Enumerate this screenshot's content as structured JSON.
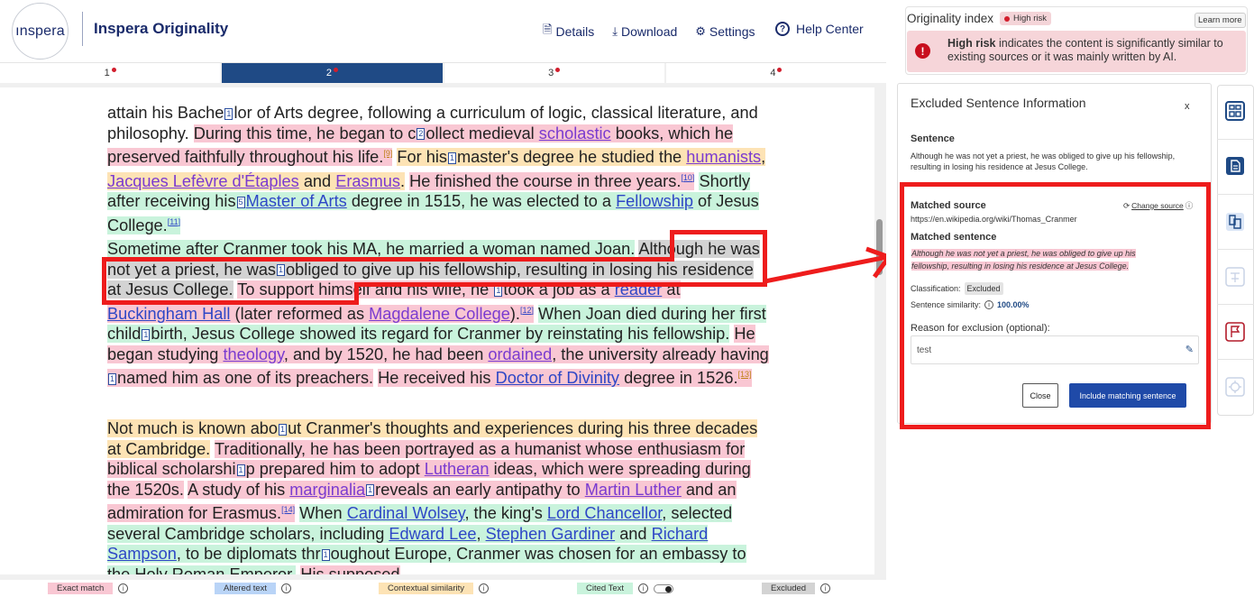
{
  "brand": {
    "logo_text": "ınspera",
    "title": "Inspera Originality"
  },
  "topnav": [
    {
      "icon": "document-icon",
      "label": "Details"
    },
    {
      "icon": "download-icon",
      "label": "Download"
    },
    {
      "icon": "gear-icon",
      "label": "Settings"
    }
  ],
  "help": {
    "icon": "question-icon",
    "label": "Help Center"
  },
  "pages": [
    "1",
    "2",
    "3",
    "4"
  ],
  "active_page": "2",
  "legend": {
    "exact": "Exact match",
    "altered": "Altered text",
    "contextual": "Contextual similarity",
    "cited": "Cited Text",
    "excluded": "Excluded"
  },
  "originality": {
    "title": "Originality index",
    "badge": "High risk",
    "learn_more": "Learn more",
    "alert_bold": "High risk",
    "alert_text": " indicates the content is significantly similar to existing sources or it was mainly written by AI."
  },
  "panel": {
    "title": "Excluded Sentence Information",
    "close_x": "x",
    "sentence_label": "Sentence",
    "sentence_text": "Although he was not yet a priest, he was obliged to give up his fellowship, resulting in losing his residence at Jesus College.",
    "matched_source_label": "Matched source",
    "matched_source_url": "https://en.wikipedia.org/wiki/Thomas_Cranmer",
    "change_source": "Change source",
    "matched_sentence_label": "Matched sentence",
    "matched_sentence_text": "Although he was not yet a priest, he was obliged to give up his fellowship, resulting in losing his residence at Jesus College.",
    "classification_label": "Classification:",
    "classification_value": "Excluded",
    "similarity_label": "Sentence similarity:",
    "similarity_value": "100.00%",
    "reason_label": "Reason for exclusion (optional):",
    "reason_value": "test",
    "close_button": "Close",
    "include_button": "Include matching sentence"
  },
  "rail_icons": [
    "overview-icon",
    "document-icon",
    "compare-icon",
    "translate-icon",
    "flag-icon",
    "ai-icon"
  ],
  "colors": {
    "exact": "#f9c7d3",
    "cited": "#c9f3dc",
    "contextual": "#fde3b5",
    "excluded": "#d3d3d3",
    "altered": "#b9d4f7",
    "brand": "#1f4a85",
    "highlight_box": "#ee1c1c"
  }
}
